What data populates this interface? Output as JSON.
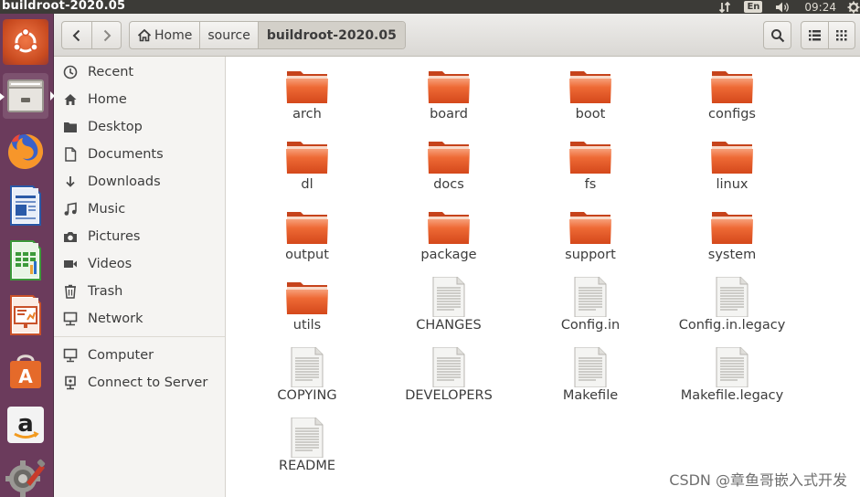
{
  "window": {
    "title": "buildroot-2020.05"
  },
  "tray": {
    "keyboard": "En",
    "time": "09:24"
  },
  "launcher": {
    "items": [
      {
        "name": "ubuntu-dash-icon"
      },
      {
        "name": "files-icon"
      },
      {
        "name": "firefox-icon"
      },
      {
        "name": "libreoffice-writer-icon"
      },
      {
        "name": "libreoffice-calc-icon"
      },
      {
        "name": "libreoffice-impress-icon"
      },
      {
        "name": "software-center-icon"
      },
      {
        "name": "amazon-icon"
      },
      {
        "name": "system-settings-icon"
      }
    ]
  },
  "breadcrumbs": [
    {
      "label": "Home"
    },
    {
      "label": "source"
    },
    {
      "label": "buildroot-2020.05"
    }
  ],
  "sidebar": {
    "places": [
      {
        "label": "Recent",
        "icon": "clock-icon"
      },
      {
        "label": "Home",
        "icon": "home-icon"
      },
      {
        "label": "Desktop",
        "icon": "folder-icon"
      },
      {
        "label": "Documents",
        "icon": "document-icon"
      },
      {
        "label": "Downloads",
        "icon": "download-icon"
      },
      {
        "label": "Music",
        "icon": "music-icon"
      },
      {
        "label": "Pictures",
        "icon": "camera-icon"
      },
      {
        "label": "Videos",
        "icon": "video-icon"
      },
      {
        "label": "Trash",
        "icon": "trash-icon"
      },
      {
        "label": "Network",
        "icon": "network-icon"
      }
    ],
    "devices": [
      {
        "label": "Computer",
        "icon": "computer-icon"
      },
      {
        "label": "Connect to Server",
        "icon": "server-icon"
      }
    ]
  },
  "files": [
    {
      "name": "arch",
      "type": "folder"
    },
    {
      "name": "board",
      "type": "folder"
    },
    {
      "name": "boot",
      "type": "folder"
    },
    {
      "name": "configs",
      "type": "folder"
    },
    {
      "name": "dl",
      "type": "folder"
    },
    {
      "name": "docs",
      "type": "folder"
    },
    {
      "name": "fs",
      "type": "folder"
    },
    {
      "name": "linux",
      "type": "folder"
    },
    {
      "name": "output",
      "type": "folder"
    },
    {
      "name": "package",
      "type": "folder"
    },
    {
      "name": "support",
      "type": "folder"
    },
    {
      "name": "system",
      "type": "folder"
    },
    {
      "name": "utils",
      "type": "folder"
    },
    {
      "name": "CHANGES",
      "type": "file"
    },
    {
      "name": "Config.in",
      "type": "file"
    },
    {
      "name": "Config.in.legacy",
      "type": "file"
    },
    {
      "name": "COPYING",
      "type": "file"
    },
    {
      "name": "DEVELOPERS",
      "type": "file"
    },
    {
      "name": "Makefile",
      "type": "file"
    },
    {
      "name": "Makefile.legacy",
      "type": "file"
    },
    {
      "name": "README",
      "type": "file"
    }
  ],
  "watermark": "CSDN @章鱼哥嵌入式开发",
  "colors": {
    "folder": "#e95420",
    "launcher": "#6b3b5c",
    "panel": "#3c3b37"
  }
}
